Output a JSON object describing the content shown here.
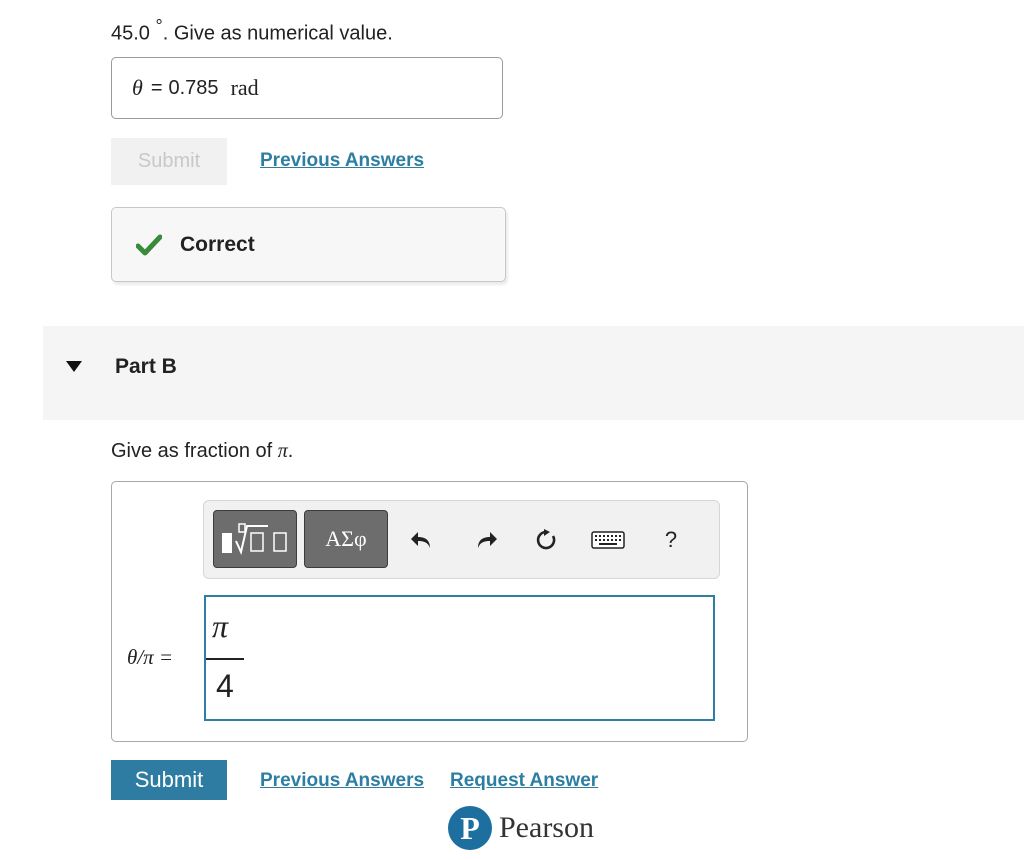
{
  "part_a": {
    "prompt_value": "45.0",
    "prompt_degree": "°",
    "prompt_rest": ". Give as numerical value.",
    "answer_symbol": "θ",
    "answer_equals": "=",
    "answer_value": "0.785",
    "answer_unit": "rad",
    "submit_label": "Submit",
    "previous_answers_label": "Previous Answers",
    "feedback_label": "Correct"
  },
  "part_b": {
    "title": "Part B",
    "prompt_text": "Give as fraction of ",
    "prompt_symbol": "π",
    "prompt_end": ".",
    "toolbar": {
      "greek_label": "ΑΣφ",
      "help_label": "?"
    },
    "answer_label": "θ/π =",
    "numerator": "π",
    "denominator": "4",
    "submit_label": "Submit",
    "previous_answers_label": "Previous Answers",
    "request_answer_label": "Request Answer"
  },
  "footer": {
    "brand": "Pearson",
    "brand_initial": "P"
  },
  "colors": {
    "accent": "#2e7ca1",
    "correct_green": "#3a8a3c",
    "pearson_blue": "#1d6fa0"
  }
}
